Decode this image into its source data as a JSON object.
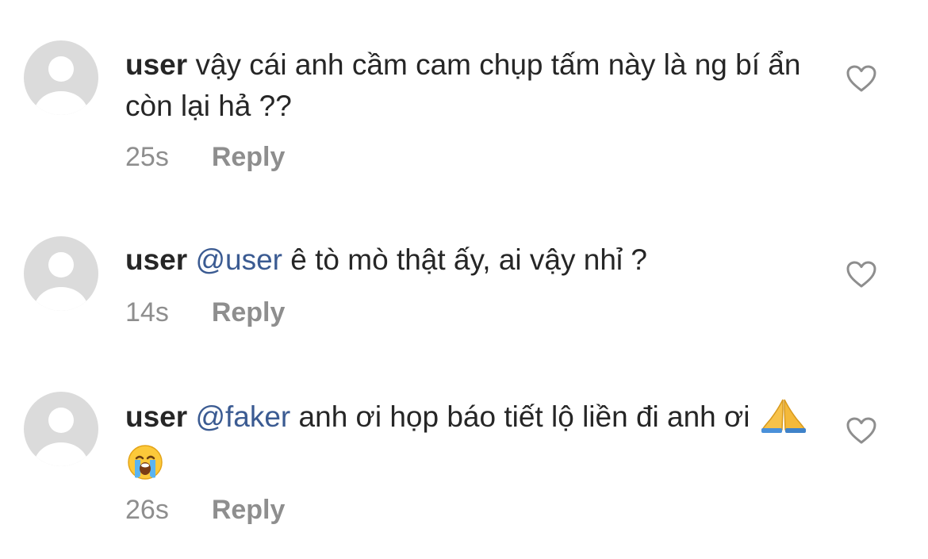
{
  "comments": [
    {
      "username": "user",
      "mention": "",
      "text": "vậy cái anh cầm cam chụp tấm này là ng bí ẩn còn lại hả ??",
      "emojis": [],
      "time": "25s",
      "reply_label": "Reply",
      "like_icon": "heart-outline-icon"
    },
    {
      "username": "user",
      "mention": "@user",
      "text": "ê tò mò thật ấy, ai vậy nhỉ ?",
      "emojis": [],
      "time": "14s",
      "reply_label": "Reply",
      "like_icon": "heart-outline-icon"
    },
    {
      "username": "user",
      "mention": "@faker",
      "text": "anh ơi họp báo tiết lộ liền đi anh ơi",
      "emojis": [
        "folded-hands-emoji",
        "loudly-crying-face-emoji"
      ],
      "time": "26s",
      "reply_label": "Reply",
      "like_icon": "heart-outline-icon"
    }
  ],
  "colors": {
    "text": "#262626",
    "meta": "#8e8e8e",
    "mention": "#3b5b92",
    "avatar_bg": "#dbdbdb"
  }
}
